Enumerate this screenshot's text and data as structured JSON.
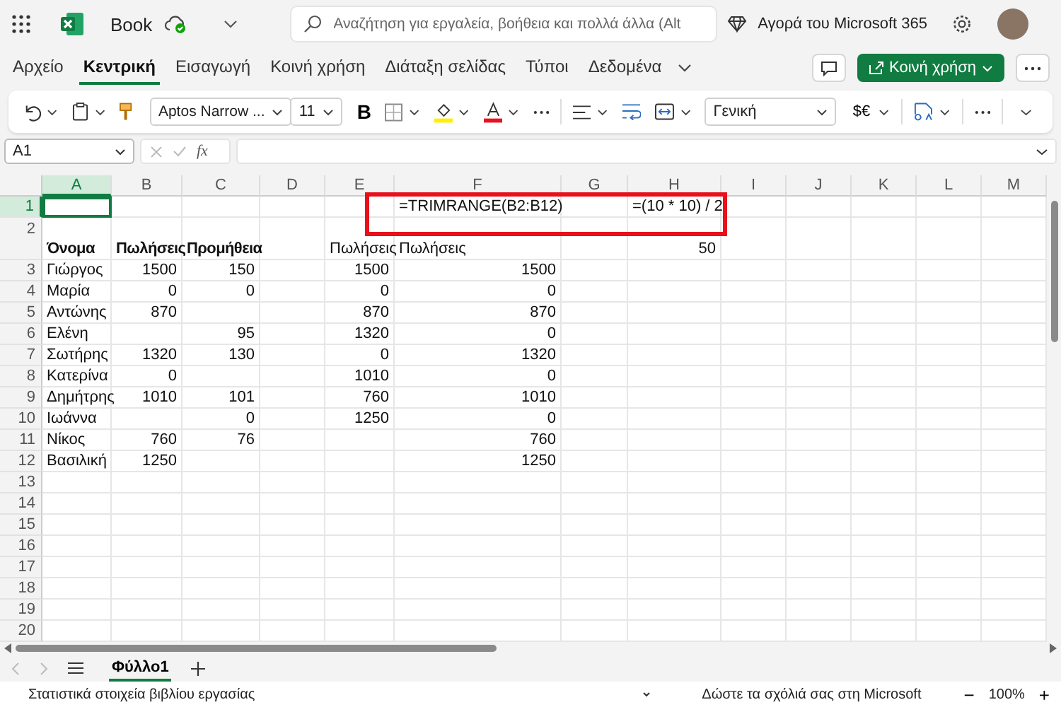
{
  "header": {
    "app_name": "Book",
    "search": {
      "placeholder": "Αναζήτηση για εργαλεία, βοήθεια και πολλά άλλα (Alt"
    },
    "buy_label": "Αγορά του Microsoft 365"
  },
  "tabs": [
    {
      "label": "Αρχείο",
      "selected": false
    },
    {
      "label": "Κεντρική",
      "selected": true
    },
    {
      "label": "Εισαγωγή",
      "selected": false
    },
    {
      "label": "Κοινή χρήση",
      "selected": false
    },
    {
      "label": "Διάταξη σελίδας",
      "selected": false
    },
    {
      "label": "Τύποι",
      "selected": false
    },
    {
      "label": "Δεδομένα",
      "selected": false
    }
  ],
  "share_button": "Κοινή χρήση",
  "ribbon": {
    "font": "Aptos Narrow ...",
    "size": "11",
    "bold": "B",
    "number_format": "Γενική",
    "currency": "$€"
  },
  "formula_bar": {
    "name_box": "A1",
    "fx": "fx"
  },
  "columns": [
    {
      "label": "A",
      "selected": true
    },
    {
      "label": "B",
      "selected": false
    },
    {
      "label": "C",
      "selected": false
    },
    {
      "label": "D",
      "selected": false
    },
    {
      "label": "E",
      "selected": false
    },
    {
      "label": "F",
      "selected": false
    },
    {
      "label": "G",
      "selected": false
    },
    {
      "label": "H",
      "selected": false
    },
    {
      "label": "I",
      "selected": false
    },
    {
      "label": "J",
      "selected": false
    },
    {
      "label": "K",
      "selected": false
    },
    {
      "label": "L",
      "selected": false
    },
    {
      "label": "M",
      "selected": false
    }
  ],
  "rows": [
    {
      "number": "1",
      "selected": true,
      "cells": {
        "F": "=TRIMRANGE(B2:B12)",
        "H": "=(10 * 10) / 2"
      }
    },
    {
      "number": "2",
      "selected": false,
      "cells": {
        "A": {
          "text": "Όνομα",
          "bold": true
        },
        "B": {
          "text": "Πωλήσεις",
          "bold": true
        },
        "C": {
          "text": "Προμήθεια",
          "bold": true
        },
        "E": "Πωλήσεις",
        "F": "Πωλήσεις",
        "H": "50"
      }
    },
    {
      "number": "3",
      "selected": false,
      "cells": {
        "A": "Γιώργος",
        "B": "1500",
        "C": "150",
        "E": "1500",
        "F": "1500"
      }
    },
    {
      "number": "4",
      "selected": false,
      "cells": {
        "A": "Μαρία",
        "B": "0",
        "C": "0",
        "E": "0",
        "F": "0"
      }
    },
    {
      "number": "5",
      "selected": false,
      "cells": {
        "A": "Αντώνης",
        "B": "870",
        "E": "870",
        "F": "870"
      }
    },
    {
      "number": "6",
      "selected": false,
      "cells": {
        "A": "Ελένη",
        "C": "95",
        "E": "1320",
        "F": "0"
      }
    },
    {
      "number": "7",
      "selected": false,
      "cells": {
        "A": "Σωτήρης",
        "B": "1320",
        "C": "130",
        "E": "0",
        "F": "1320"
      }
    },
    {
      "number": "8",
      "selected": false,
      "cells": {
        "A": "Κατερίνα",
        "B": "0",
        "E": "1010",
        "F": "0"
      }
    },
    {
      "number": "9",
      "selected": false,
      "cells": {
        "A": "Δημήτρης",
        "B": "1010",
        "C": "101",
        "E": "760",
        "F": "1010"
      }
    },
    {
      "number": "10",
      "selected": false,
      "cells": {
        "A": "Ιωάννα",
        "C": "0",
        "E": "1250",
        "F": "0"
      }
    },
    {
      "number": "11",
      "selected": false,
      "cells": {
        "A": "Νίκος",
        "B": "760",
        "C": "76",
        "F": "760"
      }
    },
    {
      "number": "12",
      "selected": false,
      "cells": {
        "A": "Βασιλική",
        "B": "1250",
        "F": "1250"
      }
    },
    {
      "number": "13",
      "selected": false,
      "cells": {}
    },
    {
      "number": "14",
      "selected": false,
      "cells": {}
    },
    {
      "number": "15",
      "selected": false,
      "cells": {}
    },
    {
      "number": "16",
      "selected": false,
      "cells": {}
    },
    {
      "number": "17",
      "selected": false,
      "cells": {}
    },
    {
      "number": "18",
      "selected": false,
      "cells": {}
    },
    {
      "number": "19",
      "selected": false,
      "cells": {}
    },
    {
      "number": "20",
      "selected": false,
      "cells": {}
    }
  ],
  "sheets": [
    {
      "label": "Φύλλο1",
      "selected": true
    }
  ],
  "status_bar": {
    "stats": "Στατιστικά στοιχεία βιβλίου εργασίας",
    "feedback": "Δώστε τα σχόλιά σας στη Microsoft",
    "zoom_out": "−",
    "zoom": "100%",
    "zoom_in": "+"
  }
}
